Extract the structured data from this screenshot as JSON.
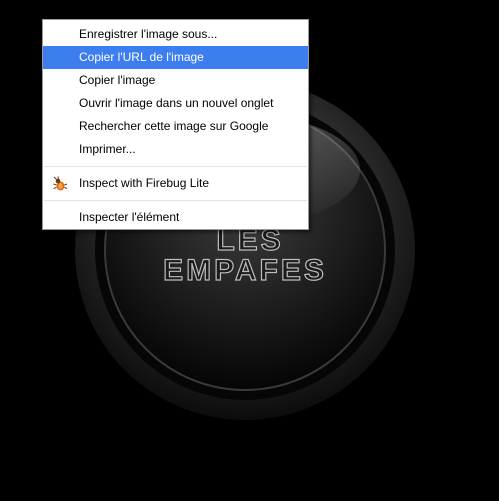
{
  "background": {
    "logo_line1": "LES",
    "logo_line2": "EMPAFES"
  },
  "context_menu": {
    "items": [
      {
        "label": "Enregistrer l'image sous...",
        "highlighted": false
      },
      {
        "label": "Copier l'URL de l'image",
        "highlighted": true
      },
      {
        "label": "Copier l'image",
        "highlighted": false
      },
      {
        "label": "Ouvrir l'image dans un nouvel onglet",
        "highlighted": false
      },
      {
        "label": "Rechercher cette image sur Google",
        "highlighted": false
      },
      {
        "label": "Imprimer...",
        "highlighted": false
      }
    ],
    "extension_item": {
      "label": "Inspect with Firebug Lite",
      "icon": "firebug-icon"
    },
    "inspect_item": {
      "label": "Inspecter l'élément"
    },
    "highlight_color": "#3c7ef0"
  }
}
